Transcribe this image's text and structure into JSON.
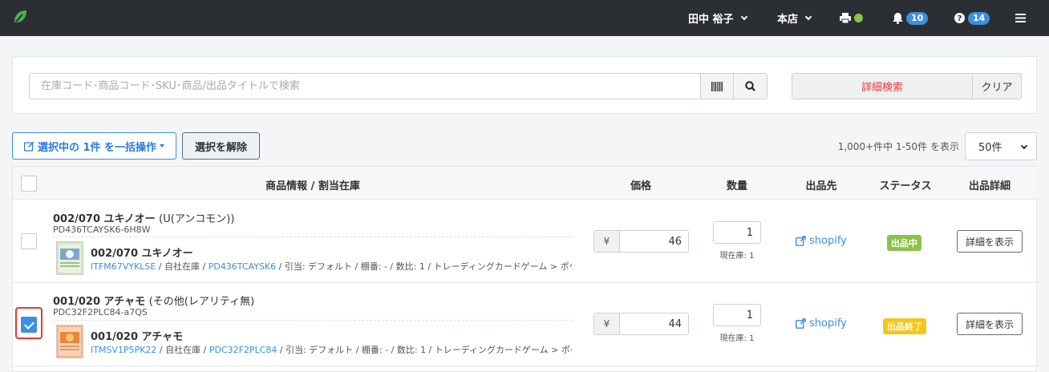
{
  "colors": {
    "topbar": "#2b2f33",
    "accent": "#3d8fe0",
    "danger": "#e03b3b",
    "status_active": "#8bc34a",
    "status_ended": "#f5c518"
  },
  "header": {
    "logo_icon": "leaf-logo",
    "user_name": "田中 裕子",
    "store_name": "本店",
    "notifications_count": "10",
    "help_count": "14",
    "printer_icon": "printer-icon",
    "bell_icon": "bell-icon",
    "help_icon": "question-circle-icon",
    "menu_icon": "hamburger-menu-icon"
  },
  "search": {
    "placeholder": "在庫コード･商品コード･SKU･商品/出品タイトルで検索",
    "value": "",
    "advanced_label": "詳細検索",
    "clear_label": "クリア"
  },
  "toolbar": {
    "bulk_label": "選択中の 1件 を一括操作",
    "deselect_label": "選択を解除",
    "count_text": "1,000+件中 1-50件 を表示",
    "per_page": "50件"
  },
  "table": {
    "headers": [
      "商品情報 / 割当在庫",
      "価格",
      "数量",
      "出品先",
      "ステータス",
      "出品詳細"
    ],
    "rows": [
      {
        "checked": false,
        "title": "002/070 ユキノオー",
        "rarity": "(U(アンコモン))",
        "code": "PD436TCAYSK6-6H8W",
        "stock_name": "002/070 ユキノオー",
        "stock_code": "ITFM67VYKLSE",
        "warehouse": " / 自社在庫 / ",
        "product_code": "PD436TCAYSK6",
        "meta_rest": " / 引当: デフォルト / 棚番: - / 数比: 1 / トレーディングカードゲーム > ポケモンカードゲー...",
        "price": "46",
        "currency": "¥",
        "quantity": "1",
        "stock_label": "現在庫: 1",
        "channel": "shopify",
        "status": "出品中",
        "detail_label": "詳細を表示"
      },
      {
        "checked": true,
        "title": "001/020 アチャモ",
        "rarity": "(その他(レアリティ無)",
        "code": "PDC32F2PLC84-a7QS",
        "stock_name": "001/020 アチャモ",
        "stock_code": "ITMSV1P5PK22",
        "warehouse": " / 自社在庫 / ",
        "product_code": "PDC32F2PLC84",
        "meta_rest": " / 引当: デフォルト / 棚番: - / 数比: 1 / トレーディングカードゲーム > ポケモンカードゲー...",
        "price": "44",
        "currency": "¥",
        "quantity": "1",
        "stock_label": "現在庫: 1",
        "channel": "shopify",
        "status": "出品終了",
        "detail_label": "詳細を表示"
      }
    ]
  }
}
